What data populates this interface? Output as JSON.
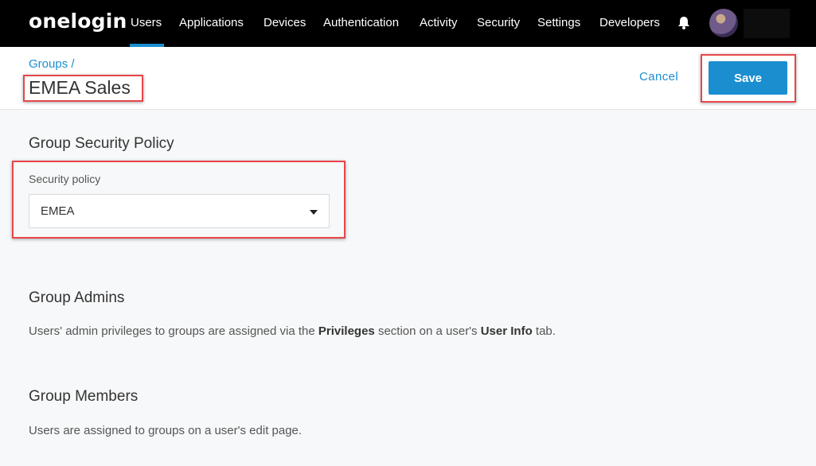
{
  "nav": {
    "logo": "onelogin",
    "items": [
      "Users",
      "Applications",
      "Devices",
      "Authentication",
      "Activity",
      "Security",
      "Settings",
      "Developers"
    ],
    "active": "Users",
    "bell_icon": "bell-icon",
    "avatar_icon": "user-avatar"
  },
  "header": {
    "breadcrumb": "Groups /",
    "title": "EMEA Sales",
    "cancel_label": "Cancel",
    "save_label": "Save"
  },
  "security_policy": {
    "section_title": "Group Security Policy",
    "field_label": "Security policy",
    "selected": "EMEA"
  },
  "admins": {
    "section_title": "Group Admins",
    "text_before": "Users' admin privileges to groups are assigned via the ",
    "bold1": "Privileges",
    "text_middle": " section on a user's ",
    "bold2": "User Info",
    "text_after": " tab."
  },
  "members": {
    "section_title": "Group Members",
    "text": "Users are assigned to groups on a user's edit page."
  },
  "colors": {
    "accent": "#1b8ed0",
    "nav_bg": "#000000",
    "highlight": "#e6464b"
  }
}
